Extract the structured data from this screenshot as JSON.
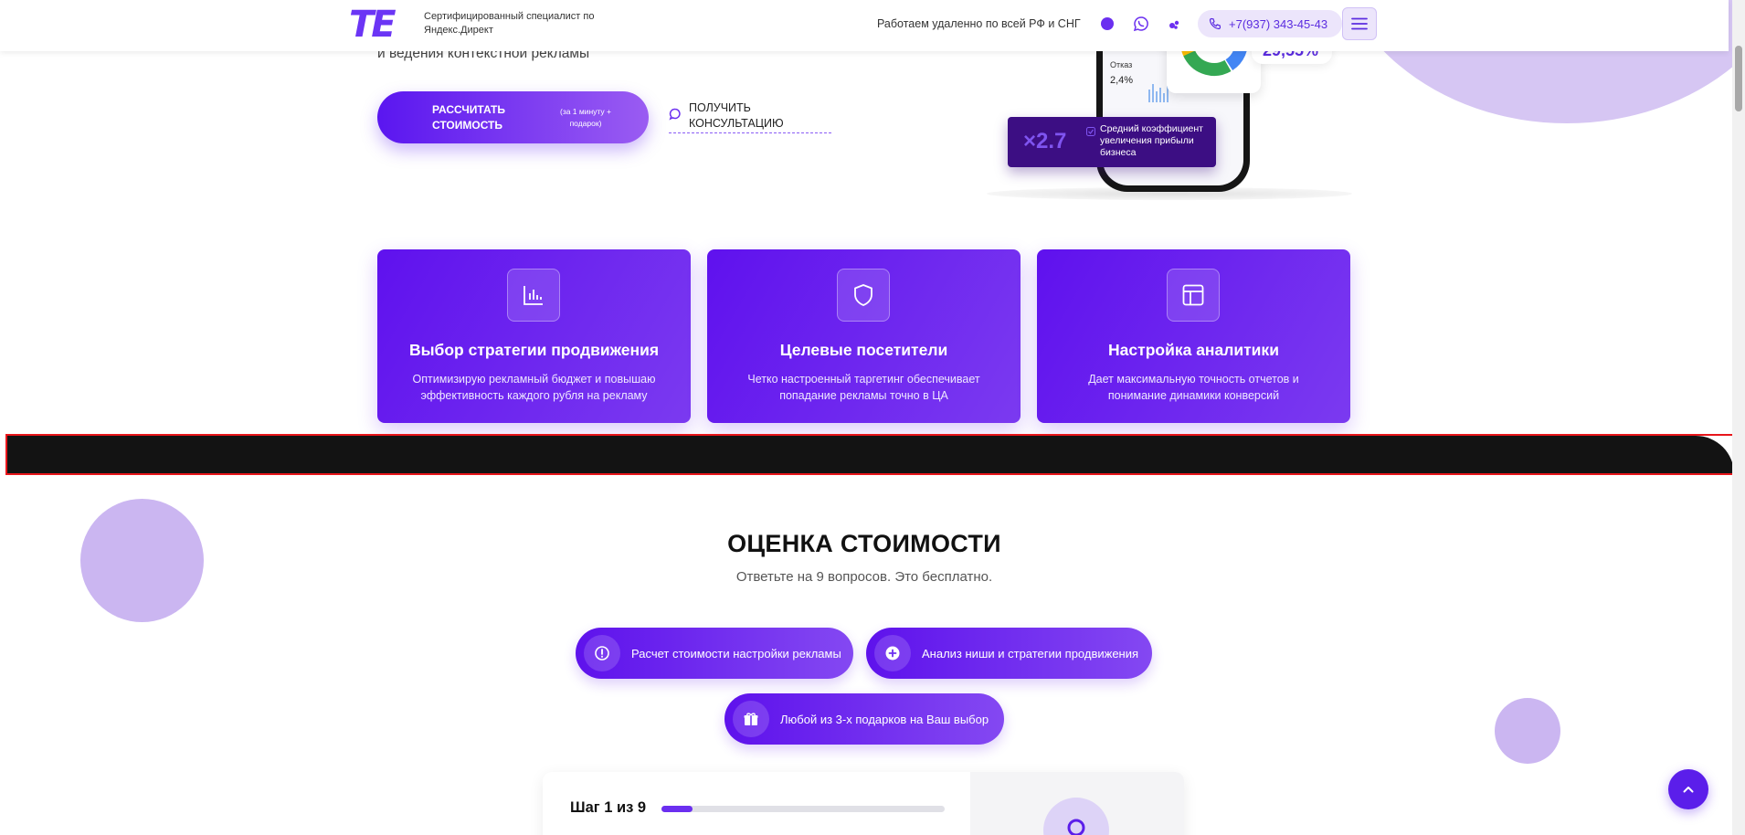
{
  "header": {
    "logo_text": "TE",
    "tagline": "Сертифицированный специалист по Яндекс.Директ",
    "remote_text": "Работаем удаленно по всей РФ и СНГ",
    "phone": "+7(937) 343-45-43",
    "icons": [
      "max-icon",
      "whatsapp-icon",
      "vk-icon",
      "phone-icon",
      "menu-icon"
    ]
  },
  "hero": {
    "subtitle": "и ведения контекстной рекламы",
    "calc_button_main": "РАССЧИТАТЬ СТОИМОСТЬ",
    "calc_button_sub": "(за 1 минуту + подарок)",
    "consult_link": "ПОЛУЧИТЬ КОНСУЛЬТАЦИЮ"
  },
  "mockup": {
    "otkaz_label": "Отказ",
    "otkaz_value": "2,4%",
    "percent_value": "29,55%",
    "stat_value": "×2.7",
    "stat_text": "Средний коэффициент увеличения прибыли бизнеса"
  },
  "features": [
    {
      "icon": "chart-icon",
      "title": "Выбор стратегии продвижения",
      "desc": "Оптимизирую рекламный бюджет и повышаю эффективность каждого рубля на рекламу"
    },
    {
      "icon": "shield-icon",
      "title": "Целевые посетители",
      "desc": "Четко настроенный таргетинг обеспечивает попадание рекламы точно в ЦА"
    },
    {
      "icon": "layout-icon",
      "title": "Настройка аналитики",
      "desc": "Дает максимальную точность отчетов и понимание динамики конверсий"
    }
  ],
  "calculator": {
    "title": "ОЦЕНКА СТОИМОСТИ",
    "subtitle": "Ответьте на 9 вопросов. Это бесплатно.",
    "pills": [
      {
        "icon": "alert-circle-icon",
        "label": "Расчет стоимости настройки рекламы"
      },
      {
        "icon": "plus-circle-icon",
        "label": "Анализ ниши и стратегии продвижения"
      },
      {
        "icon": "gift-icon",
        "label": "Любой из 3-х подарков на Ваш выбор"
      }
    ],
    "step_label": "Шаг 1 из 9",
    "progress": 0.11
  },
  "colors": {
    "accent": "#6b2ff0",
    "card_gradient_start": "#5f11ee",
    "card_gradient_end": "#7b3af0",
    "dark_banner": "#131313",
    "highlight": "#e8161b"
  }
}
